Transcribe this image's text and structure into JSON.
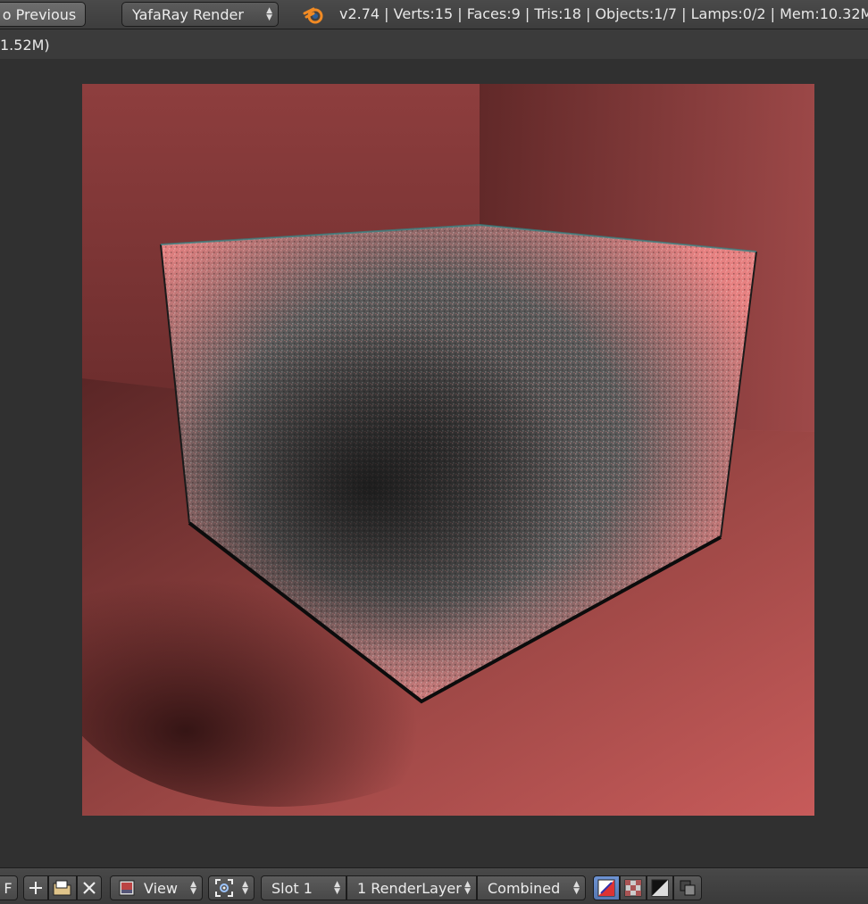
{
  "header": {
    "back_button_label": "o Previous",
    "render_engine": "YafaRay Render",
    "stats": "v2.74 | Verts:15 | Faces:9 | Tris:18 | Objects:1/7 | Lamps:0/2 | Mem:10.32M",
    "stats_overflow": "1.52M)"
  },
  "icons": {
    "logo": "blender-logo",
    "new_image": "plus-icon",
    "open_image": "folder-icon",
    "unlink_image": "close-icon",
    "editor_type": "image-editor-icon",
    "pivot": "pivot-icon",
    "draw_mode_1": "color-alpha-icon",
    "draw_mode_2": "checker-icon",
    "draw_mode_3": "z-buffer-icon",
    "draw_mode_4": "alpha-icon"
  },
  "footer": {
    "f_label": "F",
    "view_menu": "View",
    "slot": "Slot 1",
    "render_layer": "1 RenderLayer",
    "pass": "Combined"
  },
  "colors": {
    "accent": "#5a7cb8",
    "background": "#303030",
    "render_wall": "#a44d4b"
  }
}
